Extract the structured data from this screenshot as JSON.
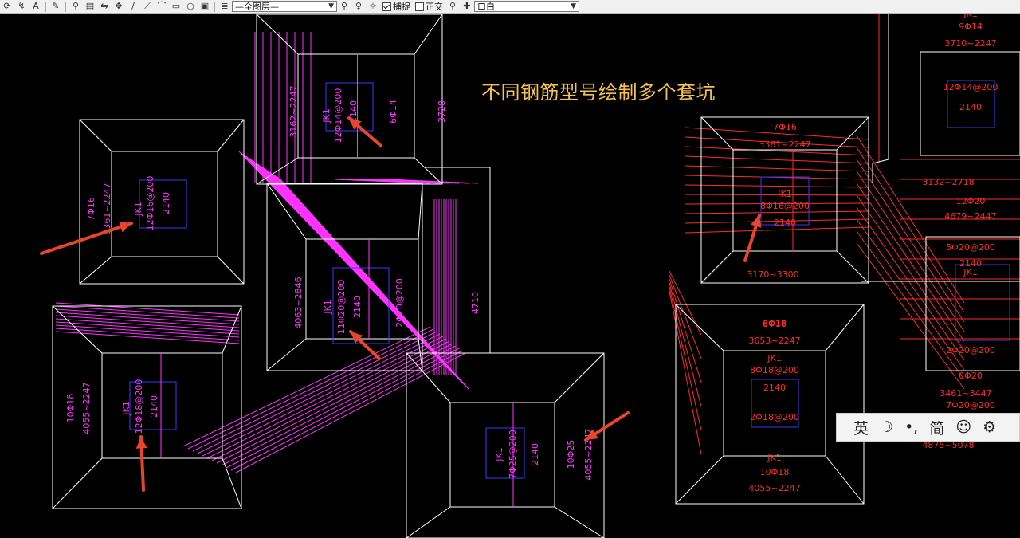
{
  "toolbar": {
    "layer_select": "—全图层—",
    "snap_label": "捕捉",
    "ortho_label": "正交",
    "color_select": "口白"
  },
  "drawing": {
    "overlay_title": "不同钢筋型号绘制多个套坑",
    "pits_left": [
      {
        "name": "JK1",
        "bars": "12Φ14@200",
        "depth": "2140",
        "side_bars": "6Φ14",
        "dims": "3162~2247",
        "extra": "3728"
      },
      {
        "name": "JK1",
        "bars": "12Φ16@200",
        "depth": "2140",
        "side_bars": "7Φ16",
        "dims": "3361~2247"
      },
      {
        "name": "JK1",
        "bars": "11Φ20@200",
        "depth": "2140",
        "side_bars": "2Φ20@200",
        "dims": "4063~2846",
        "extra": "4710"
      },
      {
        "name": "JK1",
        "bars": "12Φ18@200",
        "depth": "2140",
        "side_bars": "10Φ18",
        "dims": "4055~2247"
      },
      {
        "name": "JK1",
        "bars": "7Φ25@200",
        "depth": "2140",
        "side_bars": "10Φ25",
        "dims": "4055~2247"
      }
    ],
    "pits_right": [
      {
        "name": "JK1",
        "bars": "8Φ16@200",
        "depth": "2140",
        "side_bars": "7Φ16",
        "dims": "3361~2247"
      },
      {
        "name": "JK1",
        "bars": "8Φ18@200",
        "depth": "2140",
        "side_bars": "8Φ18",
        "dims": "3653~2247"
      },
      {
        "name": "JK1",
        "bars": "12Φ14@200",
        "depth": "2140",
        "side_bars": "9Φ14",
        "dims": "3710~2247"
      },
      {
        "name": "JK1",
        "bars": "5Φ20@200",
        "depth": "2140",
        "side_bars": "12Φ20",
        "dims": "4679~2447"
      },
      {
        "name": "JK1",
        "bars": "10Φ18",
        "dims": "4055~2247"
      }
    ],
    "right_labels": [
      "3132~2718",
      "2Φ20@200",
      "3461~3447",
      "6Φ20",
      "4875~5078",
      "7Φ20@200",
      "2Φ18@200",
      "6Φ18",
      "3170~3300"
    ]
  },
  "ime": {
    "lang": "英",
    "moon": "☽",
    "punct": "•,",
    "mode": "简",
    "emoji": "☺",
    "settings": "⚙"
  },
  "colors": {
    "magenta": "#ff33ff",
    "red": "#ff2a2a",
    "white": "#ffffff",
    "blue": "#3a3aff",
    "title": "#f5c24a"
  }
}
